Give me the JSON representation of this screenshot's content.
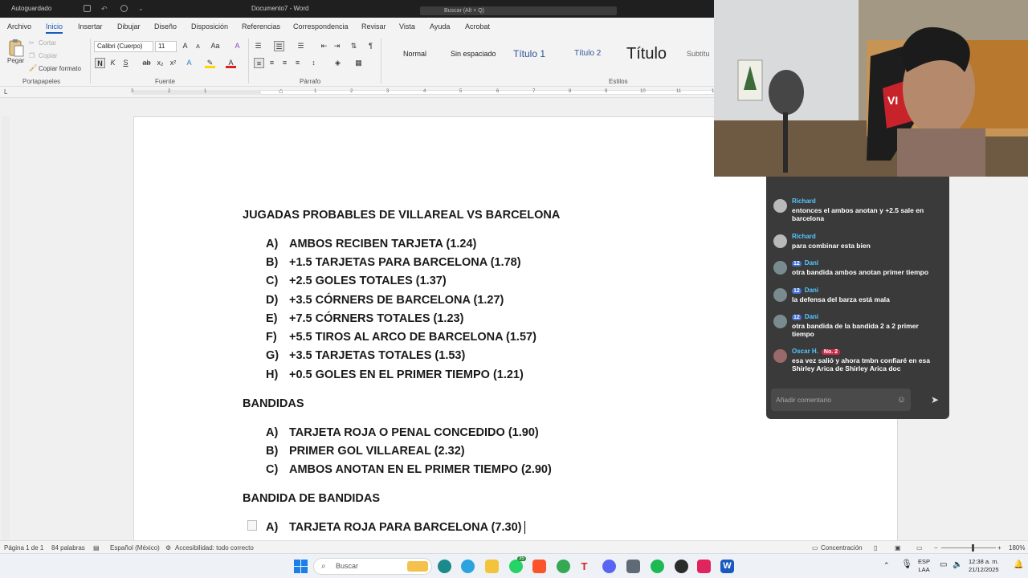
{
  "titlebar": {
    "autosave": "Autoguardado",
    "doc_title": "Documento7 - Word",
    "search_placeholder": "Buscar (Alt + Q)"
  },
  "tabs": [
    "Archivo",
    "Inicio",
    "Insertar",
    "Dibujar",
    "Diseño",
    "Disposición",
    "Referencias",
    "Correspondencia",
    "Revisar",
    "Vista",
    "Ayuda",
    "Acrobat"
  ],
  "ribbon": {
    "clipboard": {
      "paste": "Pegar",
      "cut": "Cortar",
      "copy": "Copiar",
      "format_painter": "Copiar formato",
      "group": "Portapapeles"
    },
    "font": {
      "name": "Calibri (Cuerpo)",
      "size": "11",
      "group": "Fuente",
      "case_label": "Aa"
    },
    "paragraph": {
      "group": "Párrafo"
    },
    "styles": {
      "group": "Estilos",
      "items": [
        "Normal",
        "Sin espaciado",
        "Título 1",
        "Título 2",
        "Título",
        "Subtítu"
      ]
    }
  },
  "ruler_numbers": [
    "3",
    "2",
    "1",
    "1",
    "2",
    "3",
    "4",
    "5",
    "6",
    "7",
    "8",
    "9",
    "10",
    "11",
    "12"
  ],
  "document": {
    "heading1": "JUGADAS PROBABLES DE VILLAREAL VS BARCELONA",
    "list1": [
      {
        "letter": "A)",
        "text": "AMBOS RECIBEN TARJETA (1.24)"
      },
      {
        "letter": "B)",
        "text": "+1.5 TARJETAS PARA BARCELONA (1.78)"
      },
      {
        "letter": "C)",
        "text": "+2.5 GOLES TOTALES (1.37)"
      },
      {
        "letter": "D)",
        "text": "+3.5 CÓRNERS DE BARCELONA (1.27)"
      },
      {
        "letter": "E)",
        "text": "+7.5 CÓRNERS TOTALES (1.23)"
      },
      {
        "letter": "F)",
        "text": "+5.5 TIROS AL ARCO DE BARCELONA (1.57)"
      },
      {
        "letter": "G)",
        "text": "+3.5 TARJETAS TOTALES (1.53)"
      },
      {
        "letter": "H)",
        "text": "+0.5 GOLES EN EL PRIMER TIEMPO (1.21)"
      }
    ],
    "heading2": "BANDIDAS",
    "list2": [
      {
        "letter": "A)",
        "text": "TARJETA ROJA O PENAL CONCEDIDO (1.90)"
      },
      {
        "letter": "B)",
        "text": "PRIMER GOL VILLAREAL (2.32)"
      },
      {
        "letter": "C)",
        "text": "AMBOS ANOTAN EN EL PRIMER TIEMPO (2.90)"
      }
    ],
    "heading3": "BANDIDA DE BANDIDAS",
    "list3": [
      {
        "letter": "A)",
        "text": "TARJETA ROJA PARA BARCELONA (7.30)"
      }
    ]
  },
  "statusbar": {
    "page": "Página 1 de 1",
    "words": "84 palabras",
    "language": "Español (México)",
    "accessibility": "Accesibilidad: todo correcto",
    "focus": "Concentración",
    "zoom": "180%"
  },
  "taskbar": {
    "search_label": "Buscar",
    "whatsapp_badge": "35",
    "lang_top": "ESP",
    "lang_bottom": "LAA",
    "time": "12:38 a. m.",
    "date": "21/12/2025"
  },
  "chat": {
    "messages": [
      {
        "user": "Richard",
        "badge": "",
        "rank": "",
        "text": "entonces el ambos anotan y +2.5 sale en barcelona"
      },
      {
        "user": "Richard",
        "badge": "",
        "rank": "",
        "text": "para combinar esta bien"
      },
      {
        "user": "Dani",
        "badge": "12",
        "rank": "",
        "text": "otra bandida ambos anotan primer tiempo"
      },
      {
        "user": "Dani",
        "badge": "12",
        "rank": "",
        "text": "la defensa del barza está mala"
      },
      {
        "user": "Dani",
        "badge": "12",
        "rank": "",
        "text": "otra bandida de la bandida 2 a 2 primer tiempo"
      },
      {
        "user": "Oscar H.",
        "badge": "",
        "rank": "No. 2",
        "text": "esa vez salió y ahora tmbn confiaré en esa Shirley Arica de Shirley Arica doc"
      }
    ],
    "input_placeholder": "Añadir comentario"
  },
  "webcam_text": "VI",
  "colors": {
    "word_blue": "#185abd",
    "chat_name": "#55c6ff",
    "chat_bg": "#3a3a3a"
  }
}
